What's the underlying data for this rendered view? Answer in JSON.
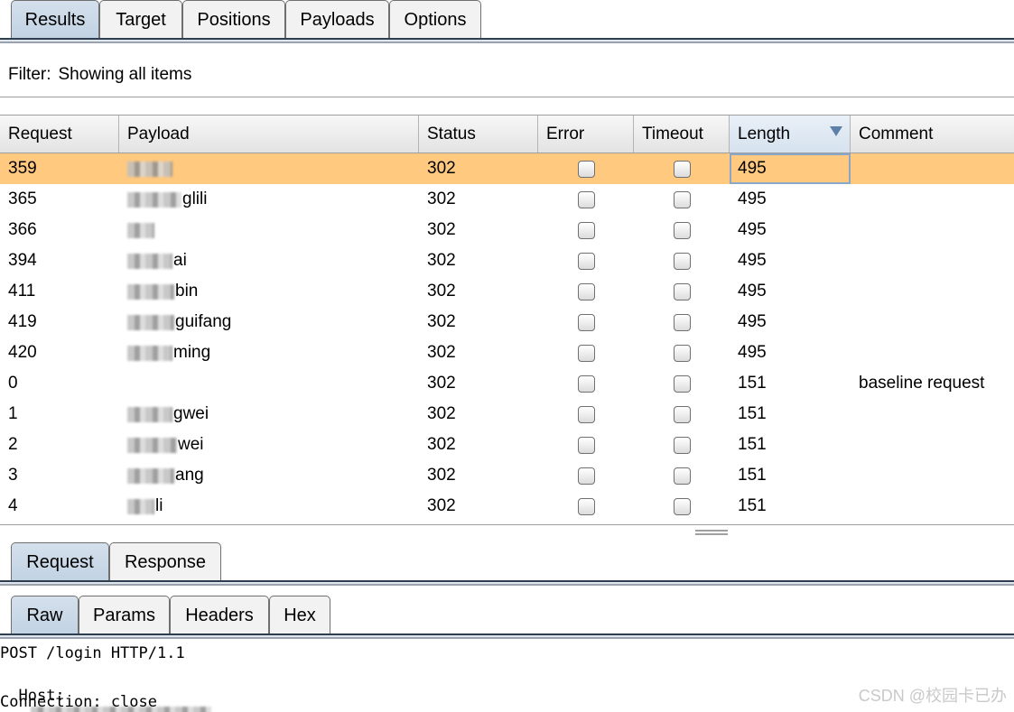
{
  "top_tabs": [
    {
      "label": "Results",
      "active": true
    },
    {
      "label": "Target",
      "active": false
    },
    {
      "label": "Positions",
      "active": false
    },
    {
      "label": "Payloads",
      "active": false
    },
    {
      "label": "Options",
      "active": false
    }
  ],
  "filter": {
    "label": "Filter:",
    "text": "Showing all items"
  },
  "table": {
    "columns": [
      "Request",
      "Payload",
      "Status",
      "Error",
      "Timeout",
      "Length",
      "Comment"
    ],
    "sorted_column": "Length",
    "rows": [
      {
        "request": "359",
        "payload": "",
        "status": "302",
        "length": "495",
        "comment": "",
        "selected": true
      },
      {
        "request": "365",
        "payload": "glili",
        "status": "302",
        "length": "495",
        "comment": ""
      },
      {
        "request": "366",
        "payload": "",
        "status": "302",
        "length": "495",
        "comment": ""
      },
      {
        "request": "394",
        "payload": "ai",
        "status": "302",
        "length": "495",
        "comment": ""
      },
      {
        "request": "411",
        "payload": "bin",
        "status": "302",
        "length": "495",
        "comment": ""
      },
      {
        "request": "419",
        "payload": "guifang",
        "status": "302",
        "length": "495",
        "comment": ""
      },
      {
        "request": "420",
        "payload": "ming",
        "status": "302",
        "length": "495",
        "comment": ""
      },
      {
        "request": "0",
        "payload": "",
        "status": "302",
        "length": "151",
        "comment": "baseline request"
      },
      {
        "request": "1",
        "payload": "gwei",
        "status": "302",
        "length": "151",
        "comment": ""
      },
      {
        "request": "2",
        "payload": "wei",
        "status": "302",
        "length": "151",
        "comment": ""
      },
      {
        "request": "3",
        "payload": "ang",
        "status": "302",
        "length": "151",
        "comment": ""
      },
      {
        "request": "4",
        "payload": "li",
        "status": "302",
        "length": "151",
        "comment": ""
      }
    ]
  },
  "message_tabs": [
    {
      "label": "Request",
      "active": true
    },
    {
      "label": "Response",
      "active": false
    }
  ],
  "view_tabs": [
    {
      "label": "Raw",
      "active": true
    },
    {
      "label": "Params",
      "active": false
    },
    {
      "label": "Headers",
      "active": false
    },
    {
      "label": "Hex",
      "active": false
    }
  ],
  "raw": {
    "line1": "POST /login HTTP/1.1",
    "host_label": "Host:",
    "host_suffix": "com",
    "line3": "Connection: close"
  },
  "watermark": "CSDN @校园卡已办"
}
